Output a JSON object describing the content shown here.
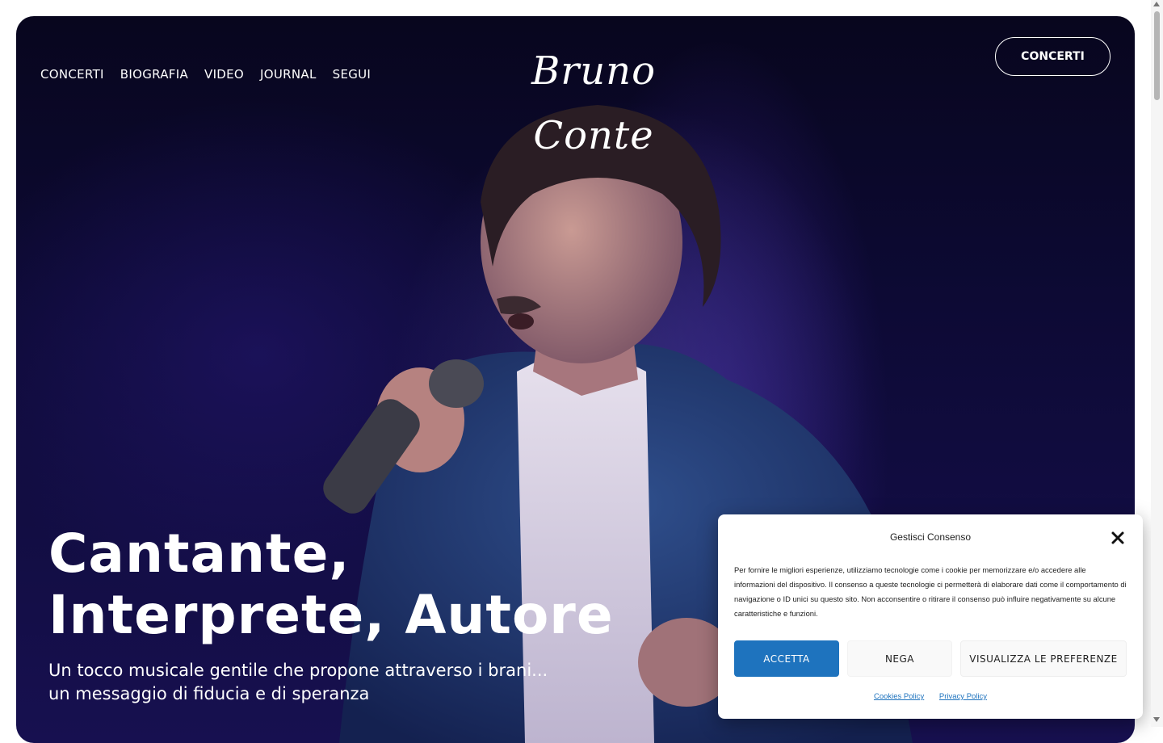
{
  "nav": {
    "items": [
      "CONCERTI",
      "BIOGRAFIA",
      "VIDEO",
      "JOURNAL",
      "SEGUI"
    ]
  },
  "logo": {
    "text": "Bruno Conte"
  },
  "header_cta": {
    "label": "CONCERTI"
  },
  "hero": {
    "headline_line1": "Cantante,",
    "headline_line2": "Interprete, Autore",
    "subline_line1": "Un tocco musicale gentile che propone attraverso i brani...",
    "subline_line2": "un messaggio di fiducia e di speranza"
  },
  "cookie_modal": {
    "title": "Gestisci Consenso",
    "text": "Per fornire le migliori esperienze, utilizziamo tecnologie come i cookie per memorizzare e/o accedere alle informazioni del dispositivo. Il consenso a queste tecnologie ci permetterà di elaborare dati come il comportamento di navigazione o ID unici su questo sito. Non acconsentire o ritirare il consenso può influire negativamente su alcune caratteristiche e funzioni.",
    "accept_label": "ACCETTA",
    "deny_label": "NEGA",
    "prefs_label": "VISUALIZZA LE PREFERENZE",
    "cookies_policy_label": "Cookies Policy",
    "privacy_policy_label": "Privacy Policy"
  },
  "colors": {
    "accent_blue": "#1e73be",
    "hero_bg": "#0d0a35",
    "text_white": "#ffffff"
  },
  "icons": {
    "close": "close-icon"
  }
}
